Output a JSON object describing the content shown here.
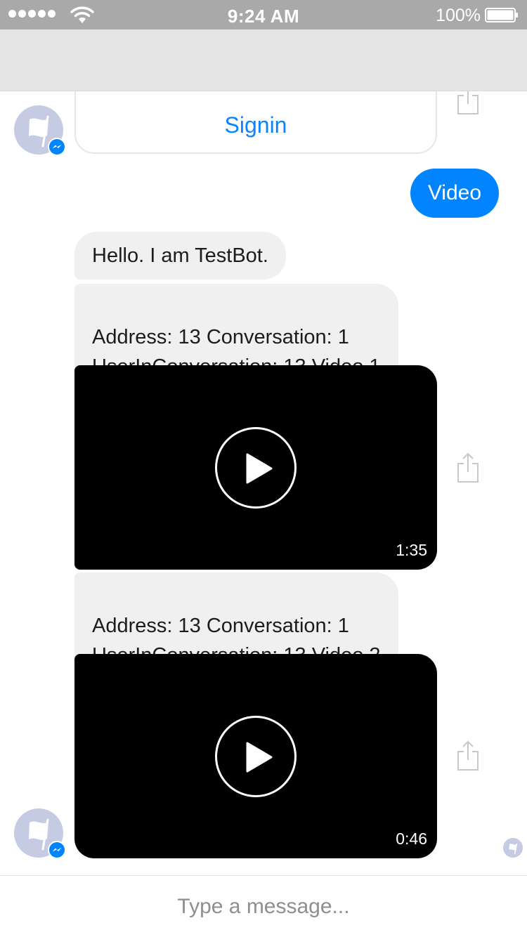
{
  "status_bar": {
    "time": "9:24 AM",
    "battery_percent": "100%",
    "signal_dots": 5,
    "icons": [
      "signal-dots-icon",
      "wifi-icon",
      "battery-icon"
    ]
  },
  "colors": {
    "accent": "#0084ff",
    "link": "#0a84ff",
    "incoming_bubble": "#f1f0f0",
    "status_bar": "#a9a9a9",
    "nav_bar": "#e5e5e5",
    "avatar": "#c5cbe3"
  },
  "messages": {
    "signin_button": "Signin",
    "outgoing": "Video",
    "incoming_1": "Hello. I am TestBot.",
    "incoming_2": "Address: 13 Conversation: 1\nUserInConversation: 13 Video 1",
    "video_1_duration": "1:35",
    "incoming_3": "Address: 13 Conversation: 1\nUserInConversation: 13 Video 2",
    "video_2_duration": "0:46"
  },
  "composer": {
    "placeholder": "Type a message..."
  }
}
